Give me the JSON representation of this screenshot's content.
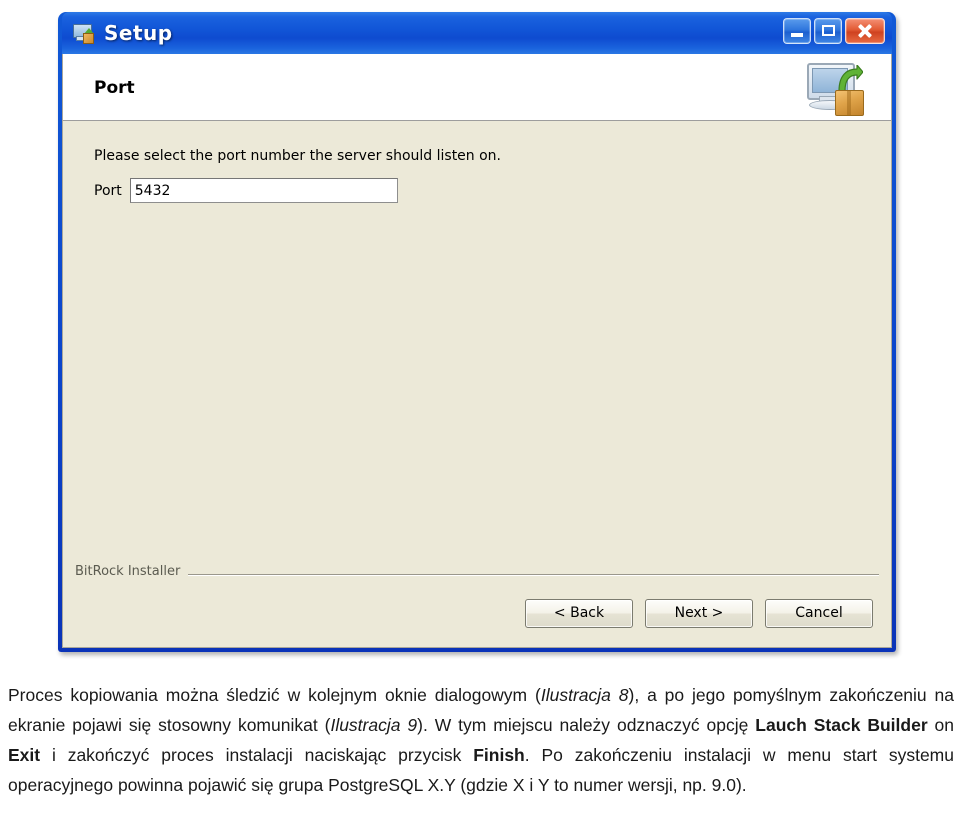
{
  "window": {
    "title": "Setup",
    "title_icon": "computer-install-icon",
    "buttons": {
      "minimize": "minimize-icon",
      "maximize": "maximize-icon",
      "close": "close-icon"
    }
  },
  "header": {
    "title": "Port",
    "icon": "computer-package-install-icon"
  },
  "content": {
    "instruction": "Please select the port number the server should listen on.",
    "port_label": "Port",
    "port_value": "5432",
    "port_placeholder": ""
  },
  "footer": {
    "brand": "BitRock Installer",
    "back_label": "< Back",
    "next_label": "Next >",
    "cancel_label": "Cancel"
  },
  "article": {
    "p1_a": "Proces kopiowania można śledzić w kolejnym oknie dialogowym (",
    "p1_i1": "Ilustracja 8",
    "p1_b": "), a po jego pomyślnym zakończeniu na ekranie pojawi się stosowny komunikat (",
    "p1_i2": "Ilustracja 9",
    "p1_c": "). W tym miejscu należy odznaczyć opcję ",
    "p1_bold1": "Lauch  Stack  Builder",
    "p1_d": " on ",
    "p1_bold2": "Exit",
    "p1_e": " i  zakończyć  proces  instalacji  naciskając  przycisk ",
    "p1_bold3": "Finish",
    "p1_f": ".  Po zakończeniu instalacji w menu start systemu operacyjnego powinna pojawić się grupa PostgreSQL X.Y (gdzie X i Y to numer wersji, np. 9.0)."
  },
  "colors": {
    "title_bar_blue": "#1257d8",
    "window_border": "#0a3fd0",
    "dialog_bg": "#ece9d8",
    "close_red": "#cf4220"
  }
}
